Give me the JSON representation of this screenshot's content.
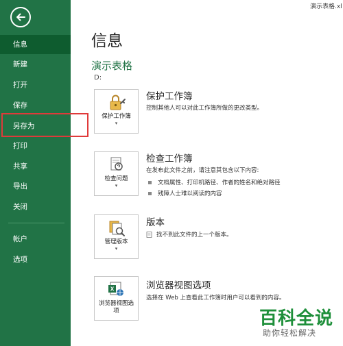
{
  "window": {
    "file_name": "演示表格.xl"
  },
  "sidebar": {
    "items": [
      {
        "label": "信息"
      },
      {
        "label": "新建"
      },
      {
        "label": "打开"
      },
      {
        "label": "保存"
      },
      {
        "label": "另存为"
      },
      {
        "label": "打印"
      },
      {
        "label": "共享"
      },
      {
        "label": "导出"
      },
      {
        "label": "关闭"
      },
      {
        "label": "帐户"
      },
      {
        "label": "选项"
      }
    ]
  },
  "main": {
    "title": "信息",
    "doc_title": "演示表格",
    "doc_path": "D:",
    "sections": [
      {
        "button_label": "保护工作簿",
        "has_caret": "▾",
        "heading": "保护工作簿",
        "description": "控制其他人可以对此工作簿所做的更改类型。"
      },
      {
        "button_label": "检查问题",
        "has_caret": "▾",
        "heading": "检查工作簿",
        "description": "在发布此文件之前，请注意其包含以下内容:",
        "bullets": [
          "文档属性、打印机路径、作者的姓名和绝对路径",
          "残障人士难以阅读的内容"
        ]
      },
      {
        "button_label": "管理版本",
        "has_caret": "▾",
        "heading": "版本",
        "description": "找不到此文件的上一个版本。"
      },
      {
        "button_label": "浏览器视图选项",
        "heading": "浏览器视图选项",
        "description": "选择在 Web 上查看此工作簿时用户可以看到的内容。"
      }
    ]
  },
  "watermark": {
    "main": "百科全说",
    "sub": "助你轻松解决"
  },
  "colors": {
    "sidebar": "#217346",
    "sidebar_active": "#0e5c2f",
    "accent": "#217346",
    "highlight": "#e03a3a",
    "watermark": "#1e8f3a"
  }
}
